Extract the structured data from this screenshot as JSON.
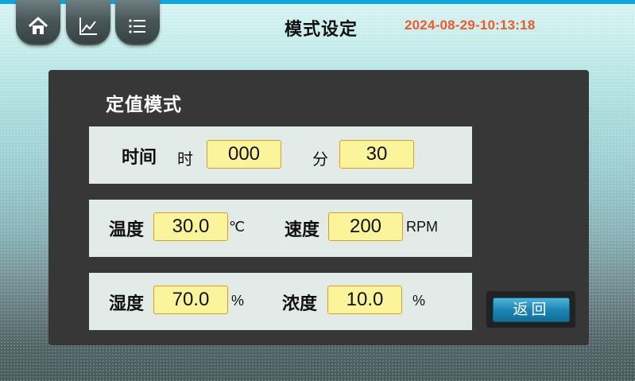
{
  "header": {
    "title": "模式设定",
    "datetime": "2024-08-29-10:13:18",
    "nav": [
      {
        "icon": "home-icon"
      },
      {
        "icon": "chart-icon"
      },
      {
        "icon": "list-icon"
      }
    ]
  },
  "panel": {
    "title": "定值模式",
    "time": {
      "label": "时间",
      "hour_label": "时",
      "hour_value": "000",
      "minute_label": "分",
      "minute_value": "30"
    },
    "temperature": {
      "label": "温度",
      "value": "30.0",
      "unit": "℃"
    },
    "speed": {
      "label": "速度",
      "value": "200",
      "unit": "RPM"
    },
    "humidity": {
      "label": "湿度",
      "value": "70.0",
      "unit": "%"
    },
    "concentration": {
      "label": "浓度",
      "value": "10.0",
      "unit": "%"
    },
    "back_label": "返回"
  },
  "colors": {
    "accent": "#0aa6df",
    "datetime": "#f05a28",
    "panel": "#373737",
    "field": "#fbf49a"
  }
}
